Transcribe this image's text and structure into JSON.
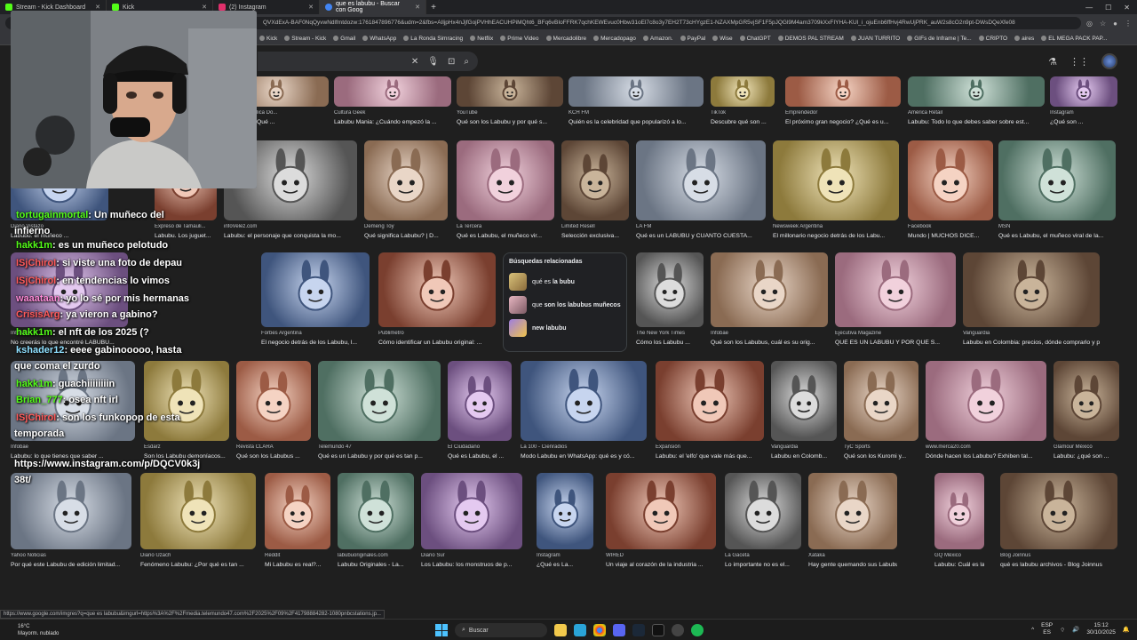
{
  "browser": {
    "tabs": [
      {
        "label": "Stream - Kick Dashboard",
        "color": "#53fc18"
      },
      {
        "label": "Kick",
        "color": "#53fc18"
      },
      {
        "label": "(2) Instagram",
        "color": "#e1306c"
      },
      {
        "label": "que es labubu - Buscar con Goog",
        "color": "#4285f4",
        "active": true
      }
    ],
    "url": "QVXdExA-BAF0NqQyvwNdlfmtdozw:1761847896776&udm=2&fbs=AIljpHx4nJjfGojPVHhEACUHPiMQht6_BFq6vBIoFFRK7qchKEWEvuc0Hbw31oEl7c8o3y7EH2T73cHYgzE1-NZAXMpGR5vjSF1F5pJQGl9M4am3709kXxFIYHA-KUl_i_ojuEnb6ffHvj4RwUjPRK_auW2s8cO2n9pt-DWsDQeXfe08",
    "bookmarks": [
      "Kick",
      "Stream - Kick",
      "Gmail",
      "WhatsApp",
      "La Ronda Simracing",
      "Netflix",
      "Prime Video",
      "Mercadolibre",
      "Mercadopago",
      "Amazon.",
      "PayPal",
      "Wise",
      "ChatGPT",
      "DEMOS PAL STREAM",
      "JUAN TURRITO",
      "GIFs de Inframe | Te...",
      "CRIPTO",
      "aires",
      "EL MEGA PACK PAP..."
    ]
  },
  "results": {
    "row0": [
      {
        "src": "Diario (República Do...",
        "cap": "y travieso! ¿Qué ..."
      },
      {
        "src": "Cultura Geek",
        "cap": "Labubu Mania: ¿Cuándo empezó la ..."
      },
      {
        "src": "YouTube",
        "cap": "Qué son los Labubu y por qué s..."
      },
      {
        "src": "KCH FM",
        "cap": "Quién es la celebridad que popularizó a lo..."
      },
      {
        "src": "TikTok",
        "cap": "Descubre qué son ..."
      },
      {
        "src": "Emprendedor",
        "cap": "El próximo gran negocio? ¿Qué es u..."
      },
      {
        "src": "América Retail",
        "cap": "Labubu: Todo lo que debes saber sobre est..."
      },
      {
        "src": "Instagram",
        "cap": "¿Qué son ..."
      }
    ],
    "row1": [
      {
        "src": "Diario Vistazo",
        "cap": "Labubu: el muñeco ..."
      },
      {
        "src": "Expreso de Tamauli...",
        "cap": "Labubu. Los juguet..."
      },
      {
        "src": "infoVelez.com",
        "cap": "Labubu: el personaje que conquista la mo..."
      },
      {
        "src": "Demeng Toy",
        "cap": "Qué significa Labubu? | D..."
      },
      {
        "src": "La Tercera",
        "cap": "Qué es Labubu, el muñeco vir..."
      },
      {
        "src": "Limited Resell",
        "cap": "Selección exclusiva..."
      },
      {
        "src": "LA FM",
        "cap": "Qué es un LABUBU y CUÁNTO CUESTA..."
      },
      {
        "src": "Newsweek Argentina",
        "cap": "El millonario negocio detrás de los Labu..."
      },
      {
        "src": "Facebook",
        "cap": "Mundo | MUCHOS DICE..."
      },
      {
        "src": "MSN",
        "cap": "Qué es Labubu, el muñeco viral de la..."
      }
    ],
    "row2": [
      {
        "src": "Infobae",
        "cap": "No creerás lo que encontré LABUBU..."
      },
      {
        "src": "Forbes Argentina",
        "cap": "El negocio detrás de los Labubu, l..."
      },
      {
        "src": "Publimetro",
        "cap": "Cómo identificar un Labubu original: ..."
      },
      {
        "src": "The New York Times",
        "cap": "Cómo los Labubu ..."
      },
      {
        "src": "Infobae",
        "cap": "Qué son los Labubus, cuál es su orig..."
      },
      {
        "src": "Ejecutiva Magazine",
        "cap": "QUÉ ES UN LABUBU Y POR QUÉ S..."
      },
      {
        "src": "Vanguardia",
        "cap": "Labubu en Colombia: precios, dónde comprarlo y p..."
      }
    ],
    "row3": [
      {
        "src": "Infobae",
        "cap": "Labubu: lo que tienes que saber ..."
      },
      {
        "src": "Esdarz",
        "cap": "Son los Labubu demoníacos..."
      },
      {
        "src": "Revista CLARA",
        "cap": "Qué son los Labubus ..."
      },
      {
        "src": "Telemundo 47",
        "cap": "Qué es un Labubu y por qué es tan p..."
      },
      {
        "src": "El Ciudadano",
        "cap": "Qué es Labubu, el ..."
      },
      {
        "src": "La 100 - Cienradios",
        "cap": "Modo Labubu en WhatsApp: qué es y có..."
      },
      {
        "src": "Expansión",
        "cap": "Labubu: el 'elfo' que vale más que..."
      },
      {
        "src": "Vanguardia",
        "cap": "Labubu en Colomb..."
      },
      {
        "src": "TyC Sports",
        "cap": "Qué son los Kuromi y..."
      },
      {
        "src": "www.merca20.com",
        "cap": "Dónde hacen los Labubu? Exhiben tal..."
      },
      {
        "src": "Glamour México",
        "cap": "Labubu: ¿qué son ..."
      }
    ],
    "row4": [
      {
        "src": "Yahoo Noticias",
        "cap": "Por qué este Labubu de edición limitad..."
      },
      {
        "src": "Diario Uzach",
        "cap": "Fenómeno Labubu: ¿Por qué es tan ..."
      },
      {
        "src": "Reddit",
        "cap": "Mi Labubu es real?..."
      },
      {
        "src": "labubuoriginales.com",
        "cap": "Labubu Originales - La..."
      },
      {
        "src": "Diario Sur",
        "cap": "Los Labubu: los monstruos de p..."
      },
      {
        "src": "Instagram",
        "cap": "¿Qué es La..."
      },
      {
        "src": "WIRED",
        "cap": "Un viaje al corazón de la industria ..."
      },
      {
        "src": "La Gaceta",
        "cap": "Lo importante no es el..."
      },
      {
        "src": "Xataka",
        "cap": "Hay gente quemando sus Labubus..."
      },
      {
        "src": "GQ México",
        "cap": "Labubu: Cuál es la..."
      },
      {
        "src": "Blog Joinnus",
        "cap": "qué es labubu archivos - Blog Joinnus"
      }
    ]
  },
  "related": {
    "title": "Búsquedas relacionadas",
    "items": [
      {
        "pre": "qué es",
        "bold": "la bubu"
      },
      {
        "pre": "que",
        "bold": "son los labubus muñecos"
      },
      {
        "pre": "",
        "bold": "new labubu"
      }
    ]
  },
  "chat": [
    {
      "user": "tortugainmortal",
      "text": ": Un muñeco del",
      "color": "green"
    },
    {
      "user": "",
      "text": "infierno",
      "color": "green"
    },
    {
      "user": "hakk1m",
      "text": ": es un muñeco pelotudo",
      "color": "green"
    },
    {
      "user": "ISjChiroI",
      "text": ": si viste una foto de depau",
      "color": "red"
    },
    {
      "user": "ISjChiroI",
      "text": ": en tendencias lo vimos",
      "color": "red"
    },
    {
      "user": "waaataan",
      "text": ": yo lo sé por mis hermanas",
      "color": "pink"
    },
    {
      "user": "CrisisArg",
      "text": ": ya vieron a gabino?",
      "color": "red"
    },
    {
      "user": "hakk1m",
      "text": ": el nft de los 2025 (?",
      "color": "green"
    },
    {
      "user": "kshader12",
      "text": ": eeee gabinooooo, hasta",
      "color": "cyan"
    },
    {
      "user": "",
      "text": "que coma el zurdo",
      "color": "cyan"
    },
    {
      "user": "hakk1m",
      "text": ": guachiiiiiiiin",
      "color": "green"
    },
    {
      "user": "Brian_777",
      "text": ": osea nft irl",
      "color": "green"
    },
    {
      "user": "ISjChiroI",
      "text": ": son los funkopop de esta",
      "color": "red"
    },
    {
      "user": "",
      "text": "temporada",
      "color": "red"
    },
    {
      "user": "",
      "text": "https://www.instagram.com/p/DQCV0k3j",
      "color": "cyan"
    },
    {
      "user": "",
      "text": "38t/",
      "color": "cyan"
    }
  ],
  "status_url": "https://www.google.com/imgres?q=que es labubu&imgurl=https%3A%2F%2Fmedia.telemundo47.com%2F2025%2F09%2F41798884282-1080pnbcstations.jp...",
  "taskbar": {
    "weather_temp": "16°C",
    "weather_desc": "Mayorm. nublado",
    "search": "Buscar",
    "lang1": "ESP",
    "lang2": "ES",
    "time": "15:12",
    "date": "30/10/2025"
  }
}
